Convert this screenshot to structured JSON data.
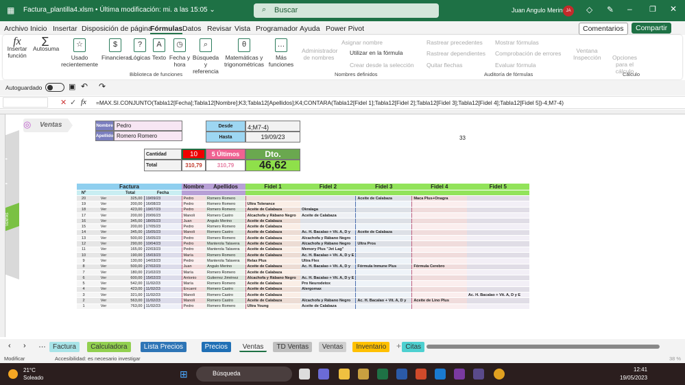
{
  "title": "Factura_plantilla4.xlsm • Última modificación: mi. a las 15:05 ⌄",
  "search": "Buscar",
  "user": {
    "name": "Juan Angulo Merino",
    "initials": "JA"
  },
  "menu": [
    "Archivo",
    "Inicio",
    "Insertar",
    "Disposición de página",
    "Fórmulas",
    "Datos",
    "Revisar",
    "Vista",
    "Programador",
    "Ayuda",
    "Power Pivot"
  ],
  "comentarios": "Comentarios",
  "compartir": "Compartir",
  "ribbon": {
    "insertar": "Insertar función",
    "autosuma": "Autosuma",
    "usado": "Usado recientemente",
    "financieras": "Financieras",
    "logicas": "Lógicas",
    "texto": "Texto",
    "fecha": "Fecha y hora",
    "busqueda": "Búsqueda y referencia",
    "matematicas": "Matemáticas y trigonométricas",
    "mas": "Más funciones",
    "biblioteca": "Biblioteca de funciones",
    "admin": "Administrador de nombres",
    "asignar": "Asignar nombre",
    "utilizar": "Utilizar en la fórmula",
    "crear": "Crear desde la selección",
    "nombres": "Nombres definidos",
    "prec": "Rastrear precedentes",
    "dep": "Rastrear dependientes",
    "quitar": "Quitar flechas",
    "mostrar": "Mostrar fórmulas",
    "comprob": "Comprobación de errores",
    "evaluar": "Evaluar fórmula",
    "auditoria": "Auditoría de fórmulas",
    "ventana": "Ventana Inspección",
    "opciones": "Opciones para el cálculo",
    "calculo": "Cálculo"
  },
  "autoguardado": "Autoguardado",
  "formula": "=MAX.SI.CONJUNTO(Tabla12[Fecha];Tabla12[Nombre];K3;Tabla12[Apellidos];K4;CONTARA(Tabla12[Fidel 1];Tabla12[Fidel 2];Tabla12[Fidel 3];Tabla12[Fidel 4];Tabla12[Fidel 5])-4;M7-4)",
  "form": {
    "logo": "Ventas",
    "side_active": "VENTAS",
    "nombre_lbl": "Nombre",
    "nombre": "Pedro",
    "apellido_lbl": "Apellido",
    "apellido": "Romero Romero",
    "desde_lbl": "Desde",
    "desde": "4;M7-4)",
    "hasta_lbl": "Hasta",
    "hasta": "19/09/23",
    "cantidad_lbl": "Cantidad",
    "cantidad": "10",
    "ultimos": "5 Últimos",
    "dto_lbl": "Dto.",
    "total_lbl": "Total",
    "total": "310,79",
    "total2": "310,79",
    "dto": "46,62",
    "extra": "33"
  },
  "table": {
    "group": "Factura",
    "nombre": "Nombre",
    "apellidos": "Apellidos",
    "headers": [
      "Nº",
      "",
      "Total",
      "Fecha"
    ],
    "fideles": [
      "Fidel 1",
      "Fidel 2",
      "Fidel 3",
      "Fidel 4",
      "Fidel 5"
    ],
    "rows": [
      [
        "20",
        "Ver",
        "325,00",
        "19/09/23",
        "Pedro",
        "Romero Romero",
        "",
        "",
        "Aceite de Calabaza",
        "Maca Plus+Onagra",
        ""
      ],
      [
        "19",
        "Ver",
        "200,00",
        "16/08/23",
        "Pedro",
        "Romero Romero",
        "Ultra Tolerance",
        "",
        "",
        "",
        ""
      ],
      [
        "18",
        "Ver",
        "423,00",
        "19/07/23",
        "Pedro",
        "Romero Romero",
        "Aceite de Calabaza",
        "Okralaga",
        "",
        "",
        ""
      ],
      [
        "17",
        "Ver",
        "200,00",
        "20/06/23",
        "Manoli",
        "Romero Castro",
        "Alcachofa y Rábano Negro",
        "Aceite de Calabaza",
        "",
        "",
        ""
      ],
      [
        "16",
        "Ver",
        "345,00",
        "18/05/23",
        "Juan",
        "Angulo Merino",
        "Aceite de Calabaza",
        "",
        "",
        "",
        ""
      ],
      [
        "15",
        "Ver",
        "200,00",
        "17/05/23",
        "Pedro",
        "Romero Romero",
        "Aceite de Calabaza",
        "",
        "",
        "",
        ""
      ],
      [
        "14",
        "Ver",
        "345,00",
        "15/05/23",
        "Manoli",
        "Romero Castro",
        "Aceite de Calabaza",
        "Ac. H. Bacalao + Vit. A, D y",
        "Aceite de Calabaza",
        "",
        ""
      ],
      [
        "13",
        "Ver",
        "500,00",
        "15/05/23",
        "Pedro",
        "Romero Romero",
        "Aceite de Calabaza",
        "Alcachofa y Rábano Negro",
        "",
        "",
        ""
      ],
      [
        "12",
        "Ver",
        "290,00",
        "10/04/23",
        "Pedro",
        "Manterola Talavera",
        "Aceite de Calabaza",
        "Alcachofa y Rábano Negro",
        "Ultra Pros",
        "",
        ""
      ],
      [
        "11",
        "Ver",
        "165,00",
        "22/03/23",
        "Pedro",
        "Manterola Talavera",
        "Aceite de Calabaza",
        "Memory Plus \"Jet Lag\"",
        "",
        "",
        ""
      ],
      [
        "10",
        "Ver",
        "190,00",
        "15/03/23",
        "María",
        "Romero Romero",
        "Aceite de Calabaza",
        "Ac. H. Bacalao + Vit. A, D y E",
        "",
        "",
        ""
      ],
      [
        "9",
        "Ver",
        "130,00",
        "14/03/23",
        "Pedro",
        "Manterola Talavera",
        "Relax Plus",
        "Ultra Flex",
        "",
        "",
        ""
      ],
      [
        "8",
        "Ver",
        "500,00",
        "27/02/23",
        "Juan",
        "Angulo Merino",
        "Aceite de Calabaza",
        "Ac. H. Bacalao + Vit. A, D y",
        "Fórmula Inmune Plus",
        "Fórmula Cerebro",
        ""
      ],
      [
        "7",
        "Ver",
        "180,00",
        "21/02/23",
        "María",
        "Romero Romero",
        "Aceite de Calabaza",
        "",
        "",
        "",
        ""
      ],
      [
        "6",
        "Ver",
        "600,00",
        "15/02/23",
        "Antonio",
        "Gutierrez Jiménez",
        "Alcachofa y Rábano Negro",
        "Ac. H. Bacalao + Vit. A, D y E",
        "",
        "",
        ""
      ],
      [
        "5",
        "Ver",
        "542,00",
        "11/02/23",
        "María",
        "Romero Romero",
        "Aceite de Calabaza",
        "Pro Neurodetox",
        "",
        "",
        ""
      ],
      [
        "4",
        "Ver",
        "423,00",
        "11/02/23",
        "Encarni",
        "Romero Castro",
        "Aceite de Calabaza",
        "Alergomax",
        "",
        "",
        ""
      ],
      [
        "3",
        "Ver",
        "321,00",
        "11/02/23",
        "Manoli",
        "Romero Castro",
        "Aceite de Calabaza",
        "",
        "",
        "",
        "Ac. H. Bacalao + Vit. A, D y E"
      ],
      [
        "2",
        "Ver",
        "563,00",
        "11/02/23",
        "Manoli",
        "Romero Castro",
        "Aceite de Calabaza",
        "Alcachofa y Rábano Negro",
        "Ac. H. Bacalao + Vit. A, D y",
        "Aceite de Lino Plus",
        ""
      ],
      [
        "1",
        "Ver",
        "763,00",
        "11/02/23",
        "Pedro",
        "Romero Romero",
        "Ultra Young",
        "Aceite de Calabaza",
        "",
        "",
        ""
      ]
    ]
  },
  "sheets": [
    "Factura",
    "Calculadora",
    "Lista Precios",
    "Precios",
    "Ventas",
    "TD Ventas",
    "Ventas",
    "Inventario",
    "Citas"
  ],
  "sheet_colors": [
    "#a8e4e8",
    "#92d050",
    "#2e75b6",
    "#1f6fb5",
    "#ffffff",
    "#bfbfbf",
    "#d0d0d0",
    "#ffc000",
    "#4dd0d0"
  ],
  "status": {
    "mode": "Modificar",
    "access": "Accesibilidad: es necesario investigar",
    "zoom": "38 %"
  },
  "taskbar": {
    "temp": "21°C",
    "weather": "Soleado",
    "search": "Búsqueda",
    "time": "12:41",
    "date": "19/05/2023"
  }
}
